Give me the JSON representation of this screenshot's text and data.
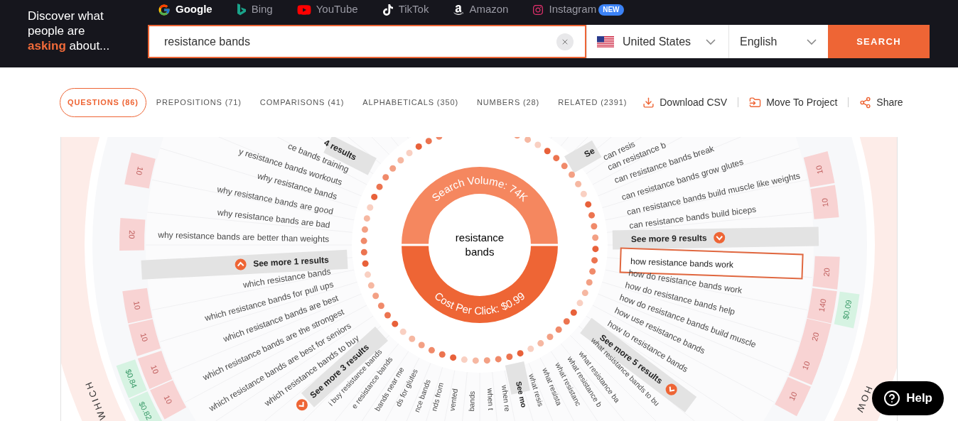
{
  "header": {
    "tagline": "Discover what people are **asking** about...",
    "engines": [
      {
        "label": "Google",
        "kind": "google",
        "selected": true
      },
      {
        "label": "Bing",
        "kind": "bing",
        "selected": false
      },
      {
        "label": "YouTube",
        "kind": "youtube",
        "selected": false
      },
      {
        "label": "TikTok",
        "kind": "tiktok",
        "selected": false
      },
      {
        "label": "Amazon",
        "kind": "amazon",
        "selected": false
      },
      {
        "label": "Instagram",
        "kind": "instagram",
        "selected": false,
        "badge": "NEW"
      }
    ],
    "search": {
      "value": "resistance bands"
    },
    "country": {
      "value": "United States"
    },
    "language": {
      "value": "English"
    },
    "search_button": "SEARCH"
  },
  "tabs": [
    {
      "label": "QUESTIONS (86)",
      "selected": true
    },
    {
      "label": "PREPOSITIONS (71)",
      "selected": false
    },
    {
      "label": "COMPARISONS (41)",
      "selected": false
    },
    {
      "label": "ALPHABETICALS (350)",
      "selected": false
    },
    {
      "label": "NUMBERS (28)",
      "selected": false
    },
    {
      "label": "RELATED (2391)",
      "selected": false
    }
  ],
  "actions": [
    {
      "label": "Download CSV",
      "kind": "download"
    },
    {
      "label": "Move To Project",
      "kind": "project"
    },
    {
      "label": "Share",
      "kind": "share"
    }
  ],
  "wheel": {
    "title": "resistance bands",
    "search_volume": "Search Volume: 74K",
    "cost_per_click": "Cost Per Click: $0.99",
    "sectors": [
      {
        "label": "WHICH"
      },
      {
        "label": "HOW"
      }
    ],
    "left_entries": [
      {
        "kind": "more",
        "text": "4 results"
      },
      {
        "kind": "question",
        "text": "ce bands training",
        "selected": false
      },
      {
        "kind": "question",
        "text": "y resistance bands workouts",
        "selected": false
      },
      {
        "kind": "question",
        "text": "why resistance bands",
        "selected": false
      },
      {
        "kind": "question",
        "text": "why resistance bands are good",
        "selected": false
      },
      {
        "kind": "question",
        "text": "why resistance bands are bad",
        "selected": false
      },
      {
        "kind": "question",
        "text": "why resistance bands are better than weights",
        "selected": false
      },
      {
        "kind": "more",
        "text": "See more 1 results",
        "expanded": true
      },
      {
        "kind": "question",
        "text": "which resistance bands",
        "selected": false
      },
      {
        "kind": "question",
        "text": "which resistance bands for pull ups",
        "selected": false
      },
      {
        "kind": "question",
        "text": "which resistance bands are best",
        "selected": false
      },
      {
        "kind": "question",
        "text": "which resistance bands are the strongest",
        "selected": false
      },
      {
        "kind": "question",
        "text": "which resistance bands are best for seniors",
        "selected": false
      },
      {
        "kind": "question",
        "text": "which resistance bands to buy",
        "selected": false
      },
      {
        "kind": "more",
        "text": "See more 3 results",
        "expanded": false
      },
      {
        "kind": "question",
        "text": "i buy resistance bands",
        "selected": false
      },
      {
        "kind": "question",
        "text": "e resistance bands",
        "selected": false
      },
      {
        "kind": "question",
        "text": "bands near me",
        "selected": false
      },
      {
        "kind": "question",
        "text": "ds for glutes",
        "selected": false
      },
      {
        "kind": "question",
        "text": "nce bands",
        "selected": false
      },
      {
        "kind": "question",
        "text": "nds from",
        "selected": false
      },
      {
        "kind": "question",
        "text": "vented",
        "selected": false
      },
      {
        "kind": "question",
        "text": "bands",
        "selected": false
      }
    ],
    "right_entries": [
      {
        "kind": "more",
        "text": "Se"
      },
      {
        "kind": "question",
        "text": "can resis",
        "selected": false
      },
      {
        "kind": "question",
        "text": "can resistance b",
        "selected": false
      },
      {
        "kind": "question",
        "text": "can resistance bands break",
        "selected": false
      },
      {
        "kind": "question",
        "text": "can resistance bands grow glutes",
        "selected": false
      },
      {
        "kind": "question",
        "text": "can resistance bands build muscle like weights",
        "selected": false
      },
      {
        "kind": "question",
        "text": "can resistance bands build biceps",
        "selected": false
      },
      {
        "kind": "more",
        "text": "See more 9 results",
        "expanded": false
      },
      {
        "kind": "question",
        "text": "how resistance bands work",
        "selected": true
      },
      {
        "kind": "question",
        "text": "how do resistance bands work",
        "selected": false
      },
      {
        "kind": "question",
        "text": "how do resistance bands help",
        "selected": false
      },
      {
        "kind": "question",
        "text": "how do resistance bands build muscle",
        "selected": false
      },
      {
        "kind": "question",
        "text": "how use resistance bands",
        "selected": false
      },
      {
        "kind": "question",
        "text": "how to resistance bands",
        "selected": false
      },
      {
        "kind": "more",
        "text": "See more 5 results",
        "expanded": false
      },
      {
        "kind": "question",
        "text": "what resistance bands to bu",
        "selected": false
      },
      {
        "kind": "question",
        "text": "what resistance ba",
        "selected": false
      },
      {
        "kind": "question",
        "text": "what resistance b",
        "selected": false
      },
      {
        "kind": "question",
        "text": "what resistanc",
        "selected": false
      },
      {
        "kind": "question",
        "text": "what resista",
        "selected": false
      },
      {
        "kind": "question",
        "text": "what resis",
        "selected": false
      },
      {
        "kind": "more",
        "text": "See mo"
      },
      {
        "kind": "question",
        "text": "when re",
        "selected": false
      },
      {
        "kind": "question",
        "text": "when t",
        "selected": false
      }
    ],
    "value_cells": [
      {
        "kind": "volume",
        "text": "10"
      },
      {
        "kind": "volume",
        "text": "20"
      },
      {
        "kind": "volume",
        "text": "10"
      },
      {
        "kind": "volume",
        "text": "10"
      },
      {
        "kind": "volume",
        "text": "10"
      },
      {
        "kind": "volume",
        "text": "10"
      },
      {
        "kind": "cpc",
        "text": "$0.84"
      },
      {
        "kind": "cpc",
        "text": "$0.82"
      },
      {
        "kind": "volume",
        "text": "10"
      },
      {
        "kind": "volume",
        "text": "10"
      },
      {
        "kind": "volume",
        "text": "20"
      },
      {
        "kind": "volume",
        "text": "140"
      },
      {
        "kind": "volume",
        "text": "20"
      },
      {
        "kind": "volume",
        "text": "10"
      },
      {
        "kind": "volume",
        "text": "10"
      },
      {
        "kind": "cpc",
        "text": "$0.09"
      }
    ]
  },
  "help_button": "Help"
}
